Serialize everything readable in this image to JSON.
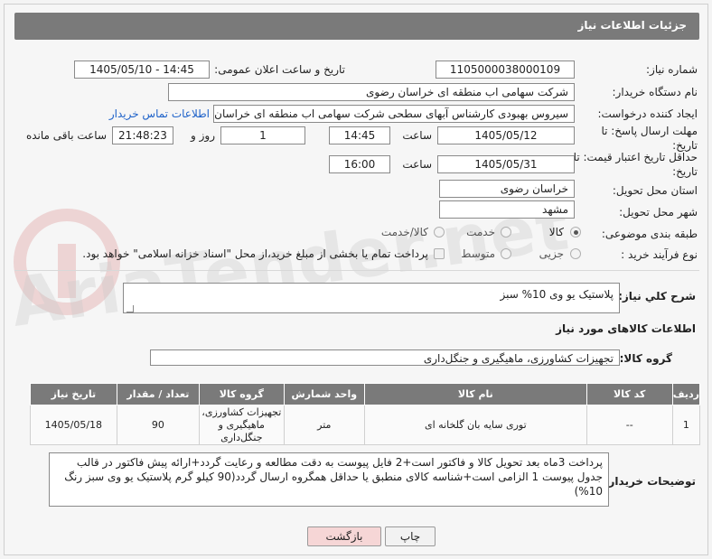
{
  "header": {
    "title": "جزئیات اطلاعات نیاز"
  },
  "fields": {
    "need_number_label": "شماره نیاز:",
    "need_number": "1105000038000109",
    "announce_label": "تاریخ و ساعت اعلان عمومی:",
    "announce_value": "1405/05/10 - 14:45",
    "buyer_label": "نام دستگاه خریدار:",
    "buyer_value": "شرکت سهامی اب منطقه ای خراسان رضوی",
    "creator_label": "ایجاد کننده درخواست:",
    "creator_value": "سیروس  بهبودی کارشناس آبهای سطحی شرکت سهامی اب منطقه ای خراسان رضوی",
    "contact_link": "اطلاعات تماس خریدار",
    "deadline_label": "مهلت ارسال پاسخ: تا تاریخ:",
    "deadline_date": "1405/05/12",
    "hour_label": "ساعت",
    "deadline_time": "14:45",
    "days_value": "1",
    "days_label": "روز و",
    "remaining_value": "21:48:23",
    "remaining_label": "ساعت باقی مانده",
    "validity_label": "حداقل تاریخ اعتبار قیمت: تا تاریخ:",
    "validity_date": "1405/05/31",
    "validity_hour_label": "ساعت",
    "validity_time": "16:00",
    "province_label": "استان محل تحویل:",
    "province_value": "خراسان رضوی",
    "city_label": "شهر محل تحویل:",
    "city_value": "مشهد",
    "category_label": "طبقه بندی موضوعی:",
    "category_options": [
      "کالا",
      "خدمت",
      "کالا/خدمت"
    ],
    "process_label": "نوع فرآیند خرید :",
    "process_options": [
      "جزیی",
      "متوسط"
    ],
    "payment_note": "پرداخت تمام یا بخشی از مبلغ خرید،از محل \"اسناد خزانه اسلامی\" خواهد بود."
  },
  "summary": {
    "label": "شرح کلي نياز:",
    "value": "پلاستیک یو وی 10% سبز"
  },
  "goods": {
    "section_title": "اطلاعات کالاهای مورد نیاز",
    "group_label": "گروه کالا:",
    "group_value": "تجهیزات کشاورزی، ماهیگیری و جنگل‌داری",
    "columns": [
      "ردیف",
      "کد کالا",
      "نام کالا",
      "واحد شمارش",
      "گروه کالا",
      "تعداد / مقدار",
      "تاریخ نیاز"
    ],
    "rows": [
      [
        "1",
        "--",
        "توری سایه بان گلخانه ای",
        "متر",
        "تجهیزات کشاورزی، ماهیگیری و جنگل‌داری",
        "90",
        "1405/05/18"
      ]
    ]
  },
  "notes": {
    "label": "توضیحات خریدار:",
    "value": "پرداخت 3ماه بعد تحویل کالا و فاکتور است+2 فایل پیوست به دقت مطالعه و رعایت گردد+ارائه پیش فاکتور در قالب جدول پیوست 1 الزامی است+شناسه کالای منطبق یا حداقل همگروه ارسال گردد(90 کیلو گرم پلاستیک یو وی سبز رنگ 10%)"
  },
  "buttons": {
    "print": "چاپ",
    "back": "بازگشت"
  },
  "watermark": {
    "text": "AriaTender.net"
  },
  "colors": {
    "header": "#7a7a7a",
    "link": "#1e62c9",
    "back_button": "#f6d6d6"
  }
}
